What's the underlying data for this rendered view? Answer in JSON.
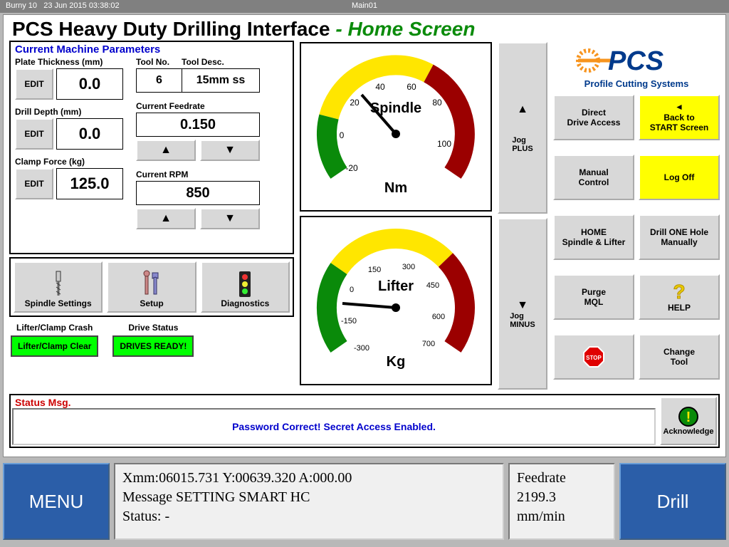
{
  "titlebar": {
    "app": "Burny 10",
    "timestamp": "23 Jun 2015  03:38:02",
    "screen": "Main01"
  },
  "header": {
    "title": "PCS Heavy Duty Drilling Interface  ",
    "suffix": "- Home Screen"
  },
  "params": {
    "title": "Current Machine Parameters",
    "plate_thickness": {
      "label": "Plate Thickness (mm)",
      "value": "0.0",
      "edit": "EDIT"
    },
    "drill_depth": {
      "label": "Drill Depth (mm)",
      "value": "0.0",
      "edit": "EDIT"
    },
    "clamp_force": {
      "label": "Clamp Force (kg)",
      "value": "125.0",
      "edit": "EDIT"
    },
    "tool_no": {
      "label": "Tool No.",
      "value": "6"
    },
    "tool_desc": {
      "label": "Tool Desc.",
      "value": "15mm ss"
    },
    "feedrate": {
      "label": "Current Feedrate",
      "value": "0.150"
    },
    "rpm": {
      "label": "Current RPM",
      "value": "850"
    }
  },
  "icons": {
    "spindle": "Spindle Settings",
    "setup": "Setup",
    "diag": "Diagnostics"
  },
  "status_inds": {
    "crash": {
      "label": "Lifter/Clamp Crash",
      "value": "Lifter/Clamp Clear"
    },
    "drive": {
      "label": "Drive Status",
      "value": "DRIVES READY!"
    }
  },
  "gauges": {
    "spindle": {
      "title": "Spindle",
      "unit": "Nm",
      "ticks": [
        "-20",
        "0",
        "20",
        "40",
        "60",
        "80",
        "100"
      ],
      "value": 20
    },
    "lifter": {
      "title": "Lifter",
      "unit": "Kg",
      "ticks": [
        "-300",
        "-150",
        "0",
        "150",
        "300",
        "450",
        "600",
        "700"
      ],
      "value": -150
    }
  },
  "jog": {
    "plus": "Jog\nPLUS",
    "minus": "Jog\nMINUS"
  },
  "logo": {
    "brand": "PCS",
    "tagline": "Profile Cutting Systems"
  },
  "buttons": {
    "direct": "Direct\nDrive Access",
    "back": "Back to\nSTART Screen",
    "manual": "Manual\nControl",
    "logoff": "Log Off",
    "home": "HOME\nSpindle & Lifter",
    "drill1": "Drill ONE Hole\nManually",
    "purge": "Purge\nMQL",
    "help": "HELP",
    "stop": "",
    "change": "Change\nTool"
  },
  "status_msg": {
    "header": "Status Msg.",
    "body": "Password Correct! Secret Access Enabled.",
    "ack": "Acknowledge"
  },
  "bottom": {
    "menu": "MENU",
    "coords": "Xmm:06015.731 Y:00639.320 A:000.00",
    "message": "Message SETTING SMART HC",
    "status": "Status:   -",
    "feedrate_lbl": "Feedrate",
    "feedrate_val": "2199.3",
    "feedrate_unit": "mm/min",
    "drill": "Drill"
  }
}
